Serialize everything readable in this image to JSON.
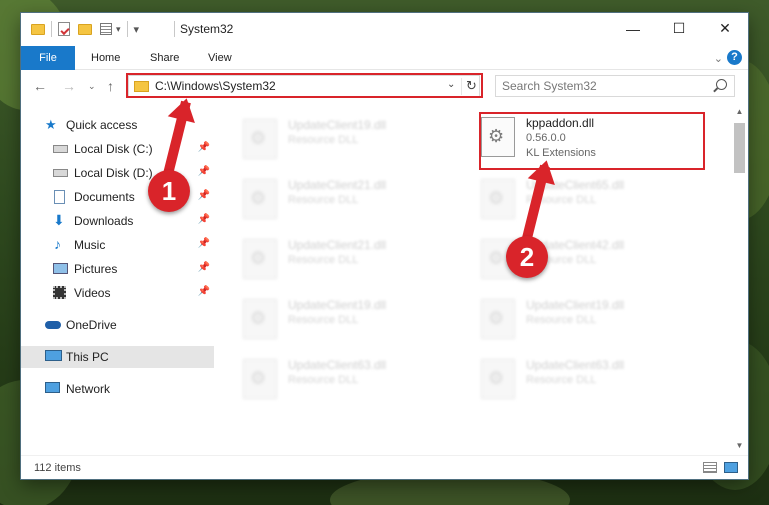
{
  "window": {
    "title": "System32",
    "controls": {
      "minimize": "—",
      "maximize": "☐",
      "close": "✕"
    }
  },
  "ribbon": {
    "tabs": [
      "File",
      "Home",
      "Share",
      "View"
    ]
  },
  "nav": {
    "address": "C:\\Windows\\System32",
    "search_placeholder": "Search System32"
  },
  "sidebar": {
    "items": [
      {
        "label": "Quick access",
        "icon": "star-icon",
        "pinned": false
      },
      {
        "label": "Local Disk (C:)",
        "icon": "drive-icon",
        "pinned": true
      },
      {
        "label": "Local Disk (D:)",
        "icon": "drive-icon",
        "pinned": true
      },
      {
        "label": "Documents",
        "icon": "documents-icon",
        "pinned": true
      },
      {
        "label": "Downloads",
        "icon": "downloads-icon",
        "pinned": true
      },
      {
        "label": "Music",
        "icon": "music-icon",
        "pinned": true
      },
      {
        "label": "Pictures",
        "icon": "pictures-icon",
        "pinned": true
      },
      {
        "label": "Videos",
        "icon": "videos-icon",
        "pinned": true
      },
      {
        "label": "OneDrive",
        "icon": "onedrive-icon",
        "pinned": false
      },
      {
        "label": "This PC",
        "icon": "this-pc-icon",
        "pinned": false,
        "selected": true
      },
      {
        "label": "Network",
        "icon": "network-icon",
        "pinned": false
      }
    ]
  },
  "files": {
    "left_column": [
      {
        "name": "UpdateClient19.dll",
        "type": "Resource DLL"
      },
      {
        "name": "UpdateClient21.dll",
        "type": "Resource DLL"
      },
      {
        "name": "UpdateClient21.dll",
        "type": "Resource DLL"
      },
      {
        "name": "UpdateClient19.dll",
        "type": "Resource DLL"
      },
      {
        "name": "UpdateClient63.dll",
        "type": "Resource DLL"
      }
    ],
    "right_column": [
      {
        "name": "kppaddon.dll",
        "version": "0.56.0.0",
        "type": "KL Extensions",
        "highlighted": true
      },
      {
        "name": "UpdateClient65.dll",
        "type": "Resource DLL"
      },
      {
        "name": "UpdateClient42.dll",
        "type": "Resource DLL"
      },
      {
        "name": "UpdateClient19.dll",
        "type": "Resource DLL"
      },
      {
        "name": "UpdateClient63.dll",
        "type": "Resource DLL"
      }
    ]
  },
  "status": {
    "item_count": "112 items"
  },
  "callouts": [
    {
      "number": "1",
      "target": "address-bar"
    },
    {
      "number": "2",
      "target": "kppaddon.dll"
    }
  ],
  "colors": {
    "accent": "#1979ca",
    "highlight": "#d9242a",
    "selected_bg": "#e5e5e5"
  }
}
